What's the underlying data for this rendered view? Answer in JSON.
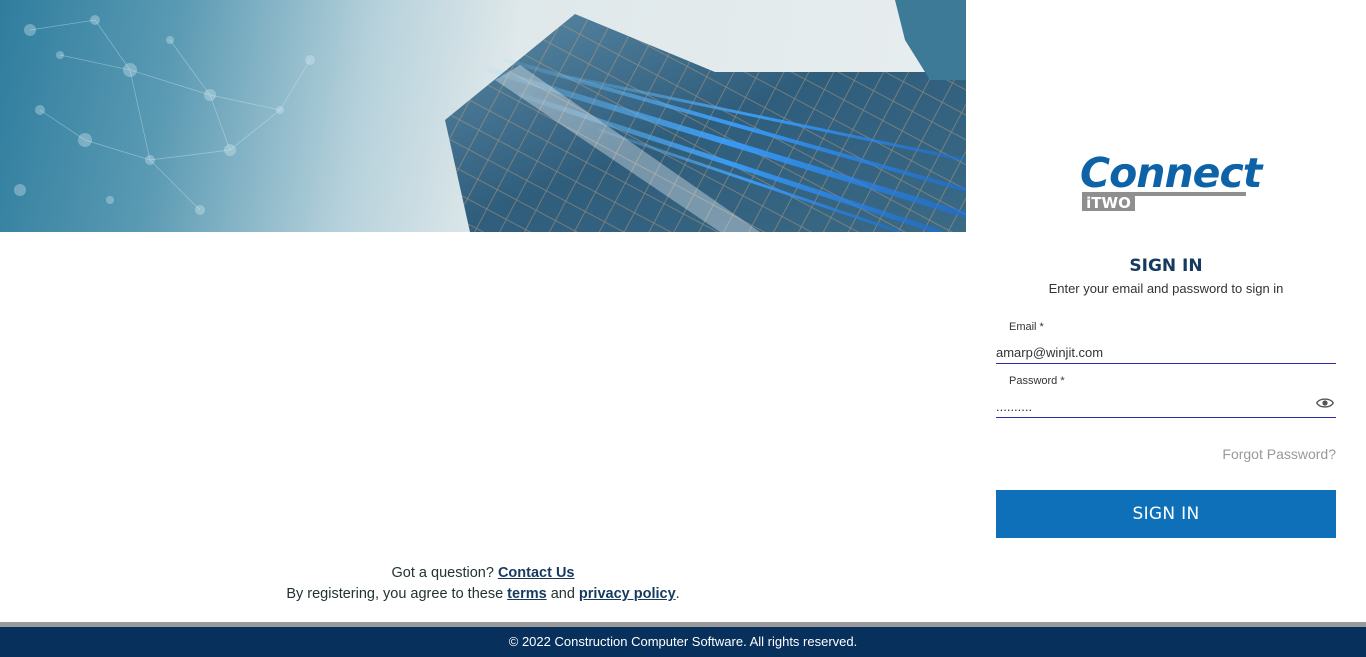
{
  "logo": {
    "connect": "Connect",
    "itwo": "iTWO"
  },
  "signin": {
    "title": "SIGN IN",
    "subtitle": "Enter your email and password to sign in",
    "email_label": "Email *",
    "email_value": "amarp@winjit.com",
    "password_label": "Password *",
    "password_value": "..........",
    "forgot": "Forgot Password?",
    "button": "SIGN IN"
  },
  "help": {
    "question": "Got a question? ",
    "contact": "Contact Us",
    "agree_prefix": "By registering, you agree to these ",
    "terms": "terms",
    "and": " and ",
    "privacy": "privacy policy",
    "period": "."
  },
  "footer": {
    "copyright": "© 2022 Construction Computer Software. All rights reserved."
  },
  "colors": {
    "primary": "#0e70b8",
    "footer": "#07315c",
    "brand": "#0d62a8"
  }
}
